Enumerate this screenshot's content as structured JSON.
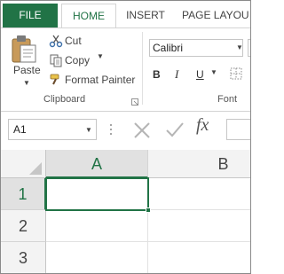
{
  "tabs": {
    "file": "FILE",
    "home": "HOME",
    "insert": "INSERT",
    "page_layout": "PAGE LAYOU"
  },
  "clipboard": {
    "paste": "Paste",
    "cut": "Cut",
    "copy": "Copy",
    "format_painter": "Format Painter",
    "group_label": "Clipboard"
  },
  "font": {
    "name": "Calibri",
    "bold": "B",
    "italic": "I",
    "underline": "U",
    "group_label": "Font"
  },
  "formula_bar": {
    "name_box": "A1",
    "fx": "fx"
  },
  "grid": {
    "columns": [
      "A",
      "B"
    ],
    "rows": [
      "1",
      "2",
      "3"
    ],
    "active_cell": "A1"
  },
  "colors": {
    "accent": "#217346"
  }
}
